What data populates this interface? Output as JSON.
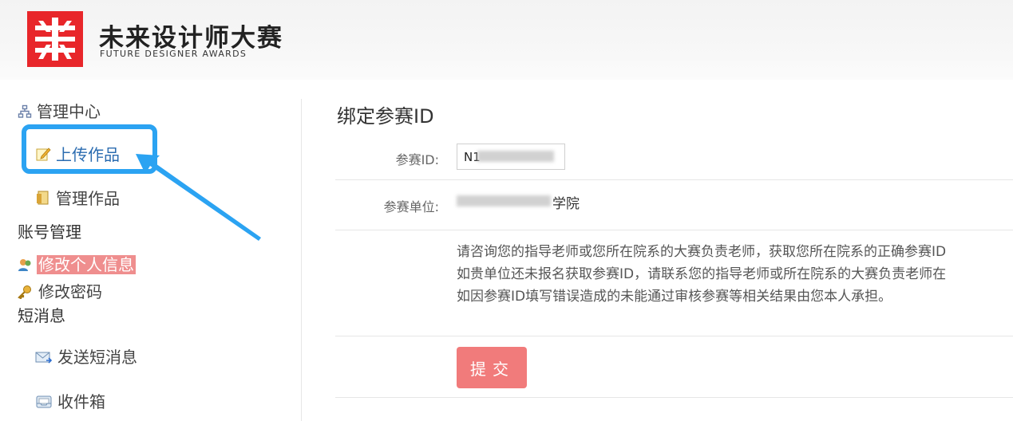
{
  "header": {
    "title": "未来设计师大赛",
    "subtitle": "FUTURE DESIGNER AWARDS"
  },
  "sidebar": {
    "manage_center": "管理中心",
    "upload_works": "上传作品",
    "manage_works": "管理作品",
    "account_section": "账号管理",
    "edit_profile": "修改个人信息",
    "change_password": "修改密码",
    "messages_section": "短消息",
    "send_message": "发送短消息",
    "inbox": "收件箱"
  },
  "main": {
    "title": "绑定参赛ID",
    "id_label": "参赛ID:",
    "id_value": "N1",
    "unit_label": "参赛单位:",
    "unit_value": "学院",
    "notes": [
      "请咨询您的指导老师或您所在院系的大赛负责老师，获取您所在院系的正确参赛ID",
      "如贵单位还未报名获取参赛ID，请联系您的指导老师或所在院系的大赛负责老师在",
      "如因参赛ID填写错误造成的未能通过审核参赛等相关结果由您本人承担。"
    ],
    "submit_label": "提交"
  },
  "colors": {
    "brand_red": "#e8262a",
    "highlight_blue": "#2ba3f2",
    "button_pink": "#f17b7b",
    "active_bg": "#ef8e8e"
  }
}
